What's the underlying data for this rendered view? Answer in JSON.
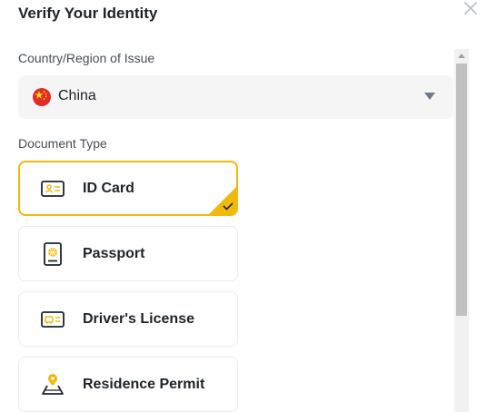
{
  "dialog": {
    "title": "Verify Your Identity",
    "close_icon": "close-icon"
  },
  "country": {
    "label": "Country/Region of Issue",
    "value": "China",
    "flag_icon": "china-flag-icon",
    "dropdown_icon": "caret-down-icon"
  },
  "document_type": {
    "label": "Document Type",
    "selected": "ID Card",
    "options": [
      {
        "label": "ID Card",
        "icon": "id-card-icon",
        "selected": true
      },
      {
        "label": "Passport",
        "icon": "passport-icon",
        "selected": false
      },
      {
        "label": "Driver's License",
        "icon": "drivers-license-icon",
        "selected": false
      },
      {
        "label": "Residence Permit",
        "icon": "residence-permit-icon",
        "selected": false
      }
    ]
  },
  "colors": {
    "accent": "#f0b90b",
    "text": "#1e2329",
    "secondary_text": "#474d57",
    "field_bg": "#f5f5f5",
    "card_border": "#eaecef"
  }
}
